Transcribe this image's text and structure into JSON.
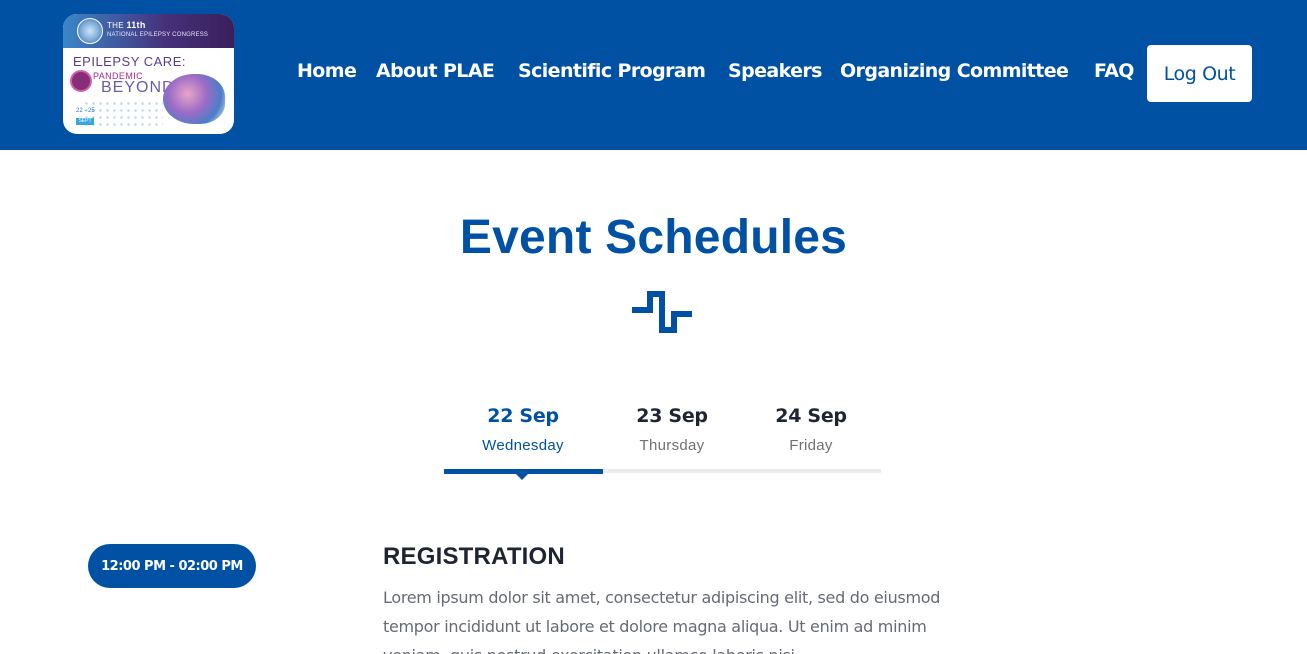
{
  "logo": {
    "line1_prefix": "THE",
    "line1_bold": "11th",
    "line2": "NATIONAL EPILEPSY CONGRESS",
    "line3": "EPILEPSY CARE:",
    "line4": "PANDEMIC",
    "line5": "BEYOND",
    "date": "22 - 25",
    "date_badge": "SEPT"
  },
  "nav": {
    "items": [
      {
        "label": "Home"
      },
      {
        "label": "About PLAE"
      },
      {
        "label": "Scientific Program"
      },
      {
        "label": "Speakers"
      },
      {
        "label": "Organizing Committee"
      },
      {
        "label": "FAQ"
      }
    ],
    "logout_label": "Log Out"
  },
  "page": {
    "title": "Event Schedules",
    "divider_icon": "pulse-icon"
  },
  "tabs": [
    {
      "date": "22 Sep",
      "day": "Wednesday",
      "active": true
    },
    {
      "date": "23 Sep",
      "day": "Thursday",
      "active": false
    },
    {
      "date": "24 Sep",
      "day": "Friday",
      "active": false
    }
  ],
  "schedule": {
    "time": "12:00 PM - 02:00 PM",
    "title": "REGISTRATION",
    "description": "Lorem ipsum dolor sit amet, consectetur adipiscing elit, sed do eiusmod tempor incididunt ut labore et dolore magna aliqua. Ut enim ad minim veniam, quis nostrud exercitation ullamco laboris nisi"
  },
  "colors": {
    "brand": "#0051a4",
    "text": "#1f2433",
    "muted": "#707070"
  }
}
